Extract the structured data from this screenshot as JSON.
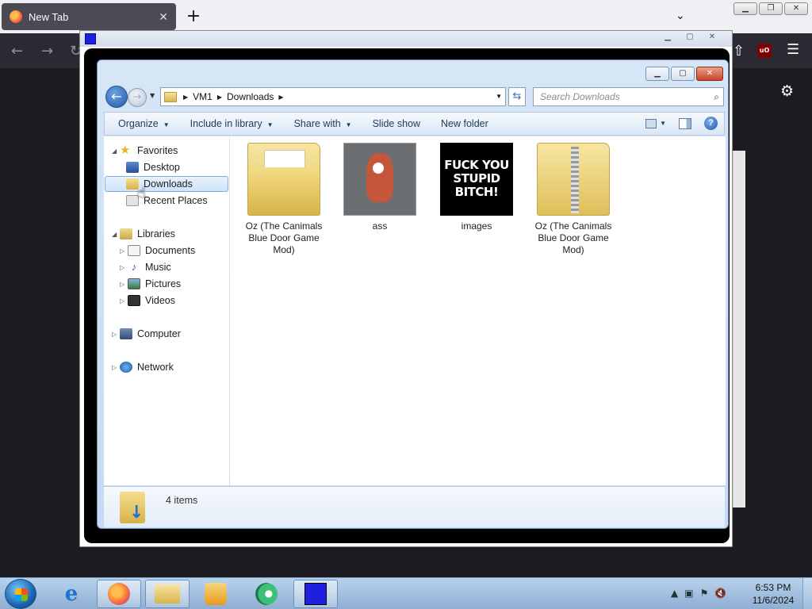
{
  "browser": {
    "tab_title": "New Tab",
    "tab_close": "✕",
    "new_tab": "+",
    "list_tabs": "⌄"
  },
  "explorer": {
    "address": {
      "crumbs": [
        "VM1",
        "Downloads"
      ]
    },
    "search_placeholder": "Search Downloads",
    "commands": {
      "organize": "Organize",
      "include_in_library": "Include in library",
      "share_with": "Share with",
      "slide_show": "Slide show",
      "new_folder": "New folder"
    },
    "nav": {
      "favorites": "Favorites",
      "desktop": "Desktop",
      "downloads": "Downloads",
      "recent_places": "Recent Places",
      "libraries": "Libraries",
      "documents": "Documents",
      "music": "Music",
      "pictures": "Pictures",
      "videos": "Videos",
      "computer": "Computer",
      "network": "Network"
    },
    "files": [
      {
        "name": "Oz (The Canimals Blue Door Game Mod)",
        "kind": "folder"
      },
      {
        "name": "ass",
        "kind": "image"
      },
      {
        "name": "images",
        "kind": "image",
        "thumb_text": "FUCK YOU STUPID BITCH!"
      },
      {
        "name": "Oz (The Canimals Blue Door Game Mod)",
        "kind": "zip-folder"
      }
    ],
    "status": "4 items"
  },
  "taskbar": {
    "time": "6:53 PM",
    "date": "11/6/2024"
  }
}
